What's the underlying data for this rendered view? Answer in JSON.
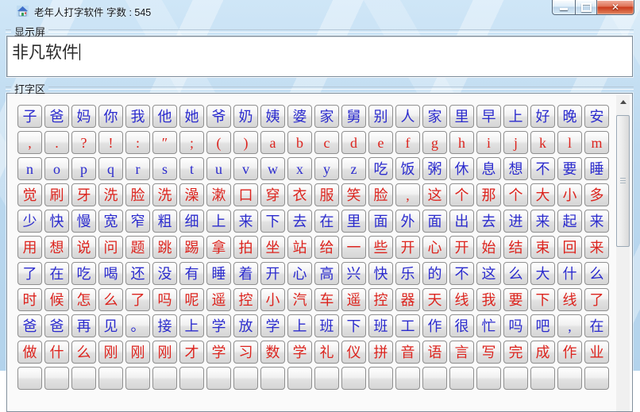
{
  "window": {
    "title": "老年人打字软件  字数 : 545",
    "close_glyph": "✕"
  },
  "display": {
    "label": "显示屏",
    "text": "非凡软件"
  },
  "keyboard": {
    "label": "打字区",
    "key_colors": {
      "blue": "#2b2bcd",
      "red": "#dc241e"
    },
    "rows": [
      {
        "color": "blue",
        "keys": [
          "子",
          "爸",
          "妈",
          "你",
          "我",
          "他",
          "她",
          "爷",
          "奶",
          "姨",
          "婆",
          "家",
          "舅",
          "别",
          "人",
          "家",
          "里",
          "早",
          "上",
          "好",
          "晚",
          "安"
        ]
      },
      {
        "color": "red",
        "keys": [
          ",",
          ".",
          "?",
          "!",
          ":",
          "″",
          ";",
          "(",
          ")",
          "a",
          "b",
          "c",
          "d",
          "e",
          "f",
          "g",
          "h",
          "i",
          "j",
          "k",
          "l",
          "m"
        ]
      },
      {
        "color": "blue",
        "keys": [
          "n",
          "o",
          "p",
          "q",
          "r",
          "s",
          "t",
          "u",
          "v",
          "w",
          "x",
          "y",
          "z",
          "吃",
          "饭",
          "粥",
          "休",
          "息",
          "想",
          "不",
          "要",
          "睡"
        ]
      },
      {
        "color": "red",
        "keys": [
          "觉",
          "刷",
          "牙",
          "洗",
          "脸",
          "洗",
          "澡",
          "漱",
          "口",
          "穿",
          "衣",
          "服",
          "笑",
          "脸",
          ",",
          "这",
          "个",
          "那",
          "个",
          "大",
          "小",
          "多"
        ]
      },
      {
        "color": "blue",
        "keys": [
          "少",
          "快",
          "慢",
          "宽",
          "窄",
          "粗",
          "细",
          "上",
          "来",
          "下",
          "去",
          "在",
          "里",
          "面",
          "外",
          "面",
          "出",
          "去",
          "进",
          "来",
          "起",
          "来"
        ]
      },
      {
        "color": "red",
        "keys": [
          "用",
          "想",
          "说",
          "问",
          "题",
          "跳",
          "踢",
          "拿",
          "拍",
          "坐",
          "站",
          "给",
          "一",
          "些",
          "开",
          "心",
          "开",
          "始",
          "结",
          "束",
          "回",
          "来"
        ]
      },
      {
        "color": "blue",
        "keys": [
          "了",
          "在",
          "吃",
          "喝",
          "还",
          "没",
          "有",
          "睡",
          "着",
          "开",
          "心",
          "高",
          "兴",
          "快",
          "乐",
          "的",
          "不",
          "这",
          "么",
          "大",
          "什",
          "么"
        ]
      },
      {
        "color": "red",
        "keys": [
          "时",
          "候",
          "怎",
          "么",
          "了",
          "吗",
          "呢",
          "遥",
          "控",
          "小",
          "汽",
          "车",
          "遥",
          "控",
          "器",
          "天",
          "线",
          "我",
          "要",
          "下",
          "线",
          "了"
        ]
      },
      {
        "color": "blue",
        "keys": [
          "爸",
          "爸",
          "再",
          "见",
          "。",
          "接",
          "上",
          "学",
          "放",
          "学",
          "上",
          "班",
          "下",
          "班",
          "工",
          "作",
          "很",
          "忙",
          "吗",
          "吧",
          ",",
          "在"
        ]
      },
      {
        "color": "red",
        "keys": [
          "做",
          "什",
          "么",
          "刚",
          "刚",
          "刚",
          "才",
          "学",
          "习",
          "数",
          "学",
          "礼",
          "仪",
          "拼",
          "音",
          "语",
          "言",
          "写",
          "完",
          "成",
          "作",
          "业"
        ]
      }
    ],
    "partial_row_key_count": 22
  }
}
